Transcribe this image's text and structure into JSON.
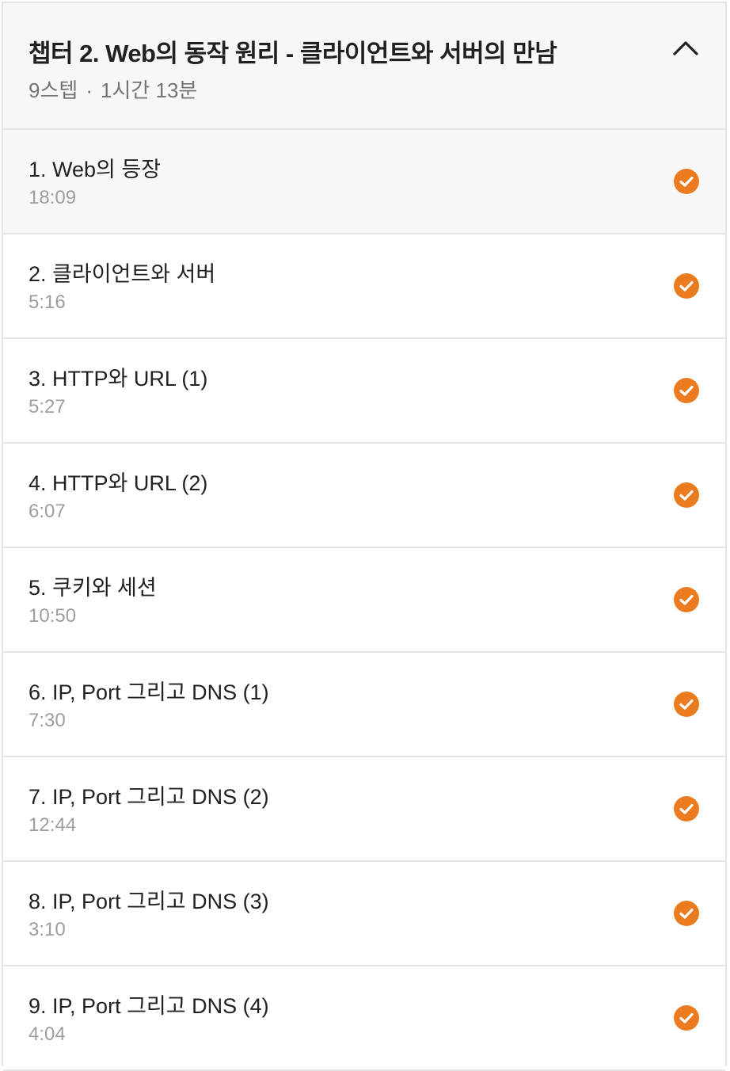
{
  "chapter": {
    "title": "챕터 2. Web의 동작 원리 - 클라이언트와 서버의 만남",
    "step_count": "9스텝",
    "separator": "·",
    "total_duration": "1시간 13분",
    "collapse_icon": "chevron-up-icon"
  },
  "accent_color": "#ec7b1f",
  "steps": [
    {
      "title": "1. Web의 등장",
      "duration": "18:09",
      "completed": true,
      "active": true
    },
    {
      "title": "2. 클라이언트와 서버",
      "duration": "5:16",
      "completed": true
    },
    {
      "title": "3. HTTP와 URL (1)",
      "duration": "5:27",
      "completed": true
    },
    {
      "title": "4. HTTP와 URL (2)",
      "duration": "6:07",
      "completed": true
    },
    {
      "title": "5. 쿠키와 세션",
      "duration": "10:50",
      "completed": true
    },
    {
      "title": "6. IP, Port 그리고 DNS (1)",
      "duration": "7:30",
      "completed": true
    },
    {
      "title": "7. IP, Port 그리고 DNS (2)",
      "duration": "12:44",
      "completed": true
    },
    {
      "title": "8. IP, Port 그리고 DNS (3)",
      "duration": "3:10",
      "completed": true
    },
    {
      "title": "9. IP, Port 그리고 DNS (4)",
      "duration": "4:04",
      "completed": true
    }
  ]
}
